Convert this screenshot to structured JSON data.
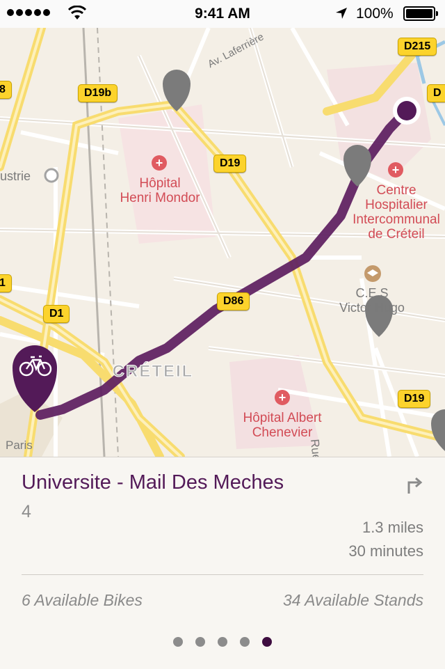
{
  "status_bar": {
    "time": "9:41 AM",
    "battery": "100%",
    "icons": [
      "signal-dots-icon",
      "wifi-icon",
      "location-arrow-icon",
      "battery-icon"
    ]
  },
  "map": {
    "road_shields": [
      "D215",
      "D19b",
      "D19",
      "D86",
      "D1",
      "D19",
      "8",
      "D",
      "1"
    ],
    "hospitals": [
      {
        "line1": "Hôpital",
        "line2": "Henri Mondor"
      },
      {
        "line1": "Centre",
        "line2": "Hospitalier",
        "line3": "Intercommunal",
        "line4": "de Créteil"
      },
      {
        "line1": "Hôpital Albert",
        "line2": "Chenevier"
      }
    ],
    "labels": {
      "city": "CRÉTEIL",
      "school_line1": "C.E.S",
      "school_line2": "Victor Hugo",
      "industrie": "ustrie",
      "street_laferriere": "Av. Laferrière",
      "street_rue": "Rue",
      "paris": "Paris"
    },
    "colors": {
      "route": "#5c1d60",
      "pin": "#531a58",
      "hospital": "#e05b61",
      "shield": "#fcd32c"
    }
  },
  "card": {
    "station_name": "Universite - Mail Des Meches",
    "station_number": "4",
    "distance": "1.3 miles",
    "duration": "30 minutes",
    "available_bikes": "6 Available Bikes",
    "available_stands": "34 Available Stands",
    "page_count": 5,
    "active_page": 5
  }
}
